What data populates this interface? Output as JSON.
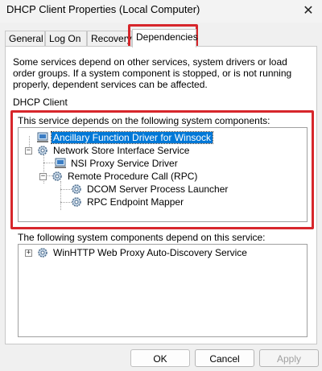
{
  "window": {
    "title": "DHCP Client Properties (Local Computer)",
    "close_glyph": "✕"
  },
  "tabs": [
    {
      "label": "General"
    },
    {
      "label": "Log On"
    },
    {
      "label": "Recovery"
    },
    {
      "label": "Dependencies"
    }
  ],
  "active_tab": "Dependencies",
  "description": "Some services depend on other services, system drivers or load order groups. If a system component is stopped, or is not running properly, dependent services can be affected.",
  "service_name": "DHCP Client",
  "depends_on": {
    "label": "This service depends on the following system components:",
    "items": [
      {
        "label": "Ancillary Function Driver for Winsock",
        "icon": "driver-icon",
        "selected": true
      },
      {
        "label": "Network Store Interface Service",
        "icon": "service-gear-icon",
        "expanded": true
      },
      {
        "label": "NSI Proxy Service Driver",
        "icon": "driver-icon"
      },
      {
        "label": "Remote Procedure Call (RPC)",
        "icon": "service-gear-icon",
        "expanded": true
      },
      {
        "label": "DCOM Server Process Launcher",
        "icon": "service-gear-icon"
      },
      {
        "label": "RPC Endpoint Mapper",
        "icon": "service-gear-icon"
      }
    ]
  },
  "dependents": {
    "label": "The following system components depend on this service:",
    "items": [
      {
        "label": "WinHTTP Web Proxy Auto-Discovery Service",
        "icon": "service-gear-icon",
        "expanded": false
      }
    ]
  },
  "buttons": {
    "ok": "OK",
    "cancel": "Cancel",
    "apply": "Apply"
  },
  "colors": {
    "highlight": "#d7262b",
    "selection": "#0078d7"
  },
  "expander_glyphs": {
    "collapse": "−",
    "expand": "+"
  }
}
